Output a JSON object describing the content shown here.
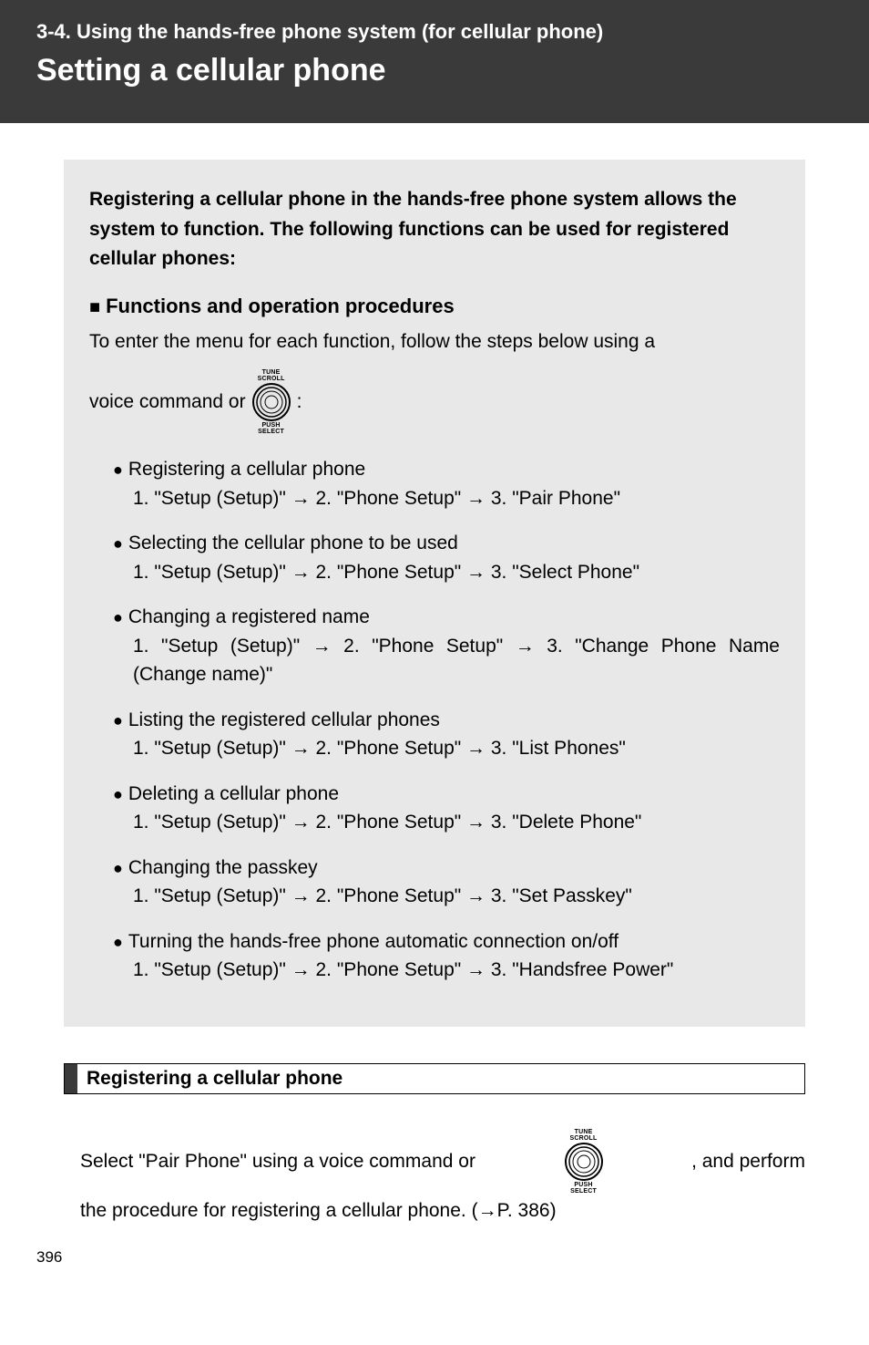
{
  "header": {
    "breadcrumb": "3-4. Using the hands-free phone system (for cellular phone)",
    "title": "Setting a cellular phone"
  },
  "intro": "Registering a cellular phone in the hands-free phone system allows the system to function. The following functions can be used for registered cellular phones:",
  "functions_heading": "Functions and operation procedures",
  "enter_menu_text": "To enter the menu for each function, follow the steps below using a",
  "voice_command_prefix": "voice command or ",
  "voice_command_suffix": " :",
  "knob": {
    "top": "TUNE\nSCROLL",
    "bottom": "PUSH\nSELECT"
  },
  "items": [
    {
      "title": "Registering a cellular phone",
      "path": "1. \"Setup (Setup)\" → 2. \"Phone Setup\" → 3. \"Pair Phone\""
    },
    {
      "title": "Selecting the cellular phone to be used",
      "path": "1. \"Setup (Setup)\" → 2. \"Phone Setup\" → 3. \"Select Phone\""
    },
    {
      "title": "Changing a registered name",
      "path": "1. \"Setup (Setup)\" → 2. \"Phone Setup\" → 3. \"Change Phone Name (Change name)\""
    },
    {
      "title": "Listing the registered cellular phones",
      "path": "1. \"Setup (Setup)\" → 2. \"Phone Setup\" → 3. \"List Phones\""
    },
    {
      "title": "Deleting a cellular phone",
      "path": "1. \"Setup (Setup)\" → 2. \"Phone Setup\" → 3. \"Delete Phone\""
    },
    {
      "title": "Changing the passkey",
      "path": "1. \"Setup (Setup)\" → 2. \"Phone Setup\" → 3. \"Set Passkey\""
    },
    {
      "title": "Turning the hands-free phone automatic connection on/off",
      "path": "1. \"Setup (Setup)\" → 2. \"Phone Setup\" → 3. \"Handsfree Power\""
    }
  ],
  "section_bar": "Registering a cellular phone",
  "bottom": {
    "line1a": "Select \"Pair Phone\" using a voice command or ",
    "line1b": " , and perform",
    "line2": "the procedure for registering a cellular phone. (→P. 386)"
  },
  "page_number": "396"
}
